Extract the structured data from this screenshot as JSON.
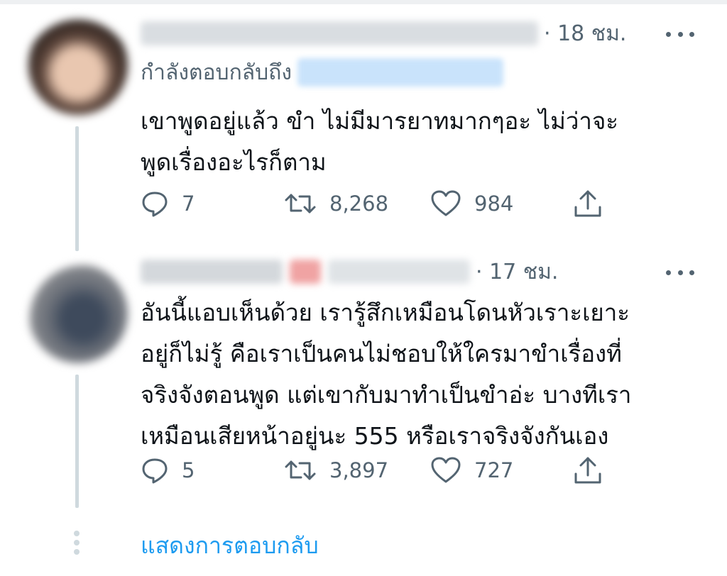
{
  "tweets": [
    {
      "time": "· 18 ชม.",
      "reply_prefix": "กำลังตอบกลับถึง",
      "text": "เขาพูดอยู่แล้ว ขำ ไม่มีมารยาทมากๆอะ ไม่ว่าจะ\nพูดเรื่องอะไรก็ตาม",
      "replies": "7",
      "retweets": "8,268",
      "likes": "984"
    },
    {
      "time": "· 17 ชม.",
      "text": "อันนี้แอบเห็นด้วย เรารู้สึกเหมือนโดนหัวเราะเยาะ\nอยู่ก็ไม่รู้ คือเราเป็นคนไม่ชอบให้ใครมาขำเรื่องที่\nจริงจังตอนพูด แต่เขากับมาทำเป็นขำอ่ะ บางทีเรา\nเหมือนเสียหน้าอยู่นะ 555 หรือเราจริงจังกันเอง",
      "replies": "5",
      "retweets": "3,897",
      "likes": "727"
    }
  ],
  "show_replies_label": "แสดงการตอบกลับ",
  "icons": {
    "reply": "reply-icon",
    "retweet": "retweet-icon",
    "like": "heart-icon",
    "share": "share-icon",
    "more": "more-icon"
  },
  "colors": {
    "muted": "#536471",
    "link": "#1d9bf0",
    "thread_line": "#cfd9de"
  }
}
